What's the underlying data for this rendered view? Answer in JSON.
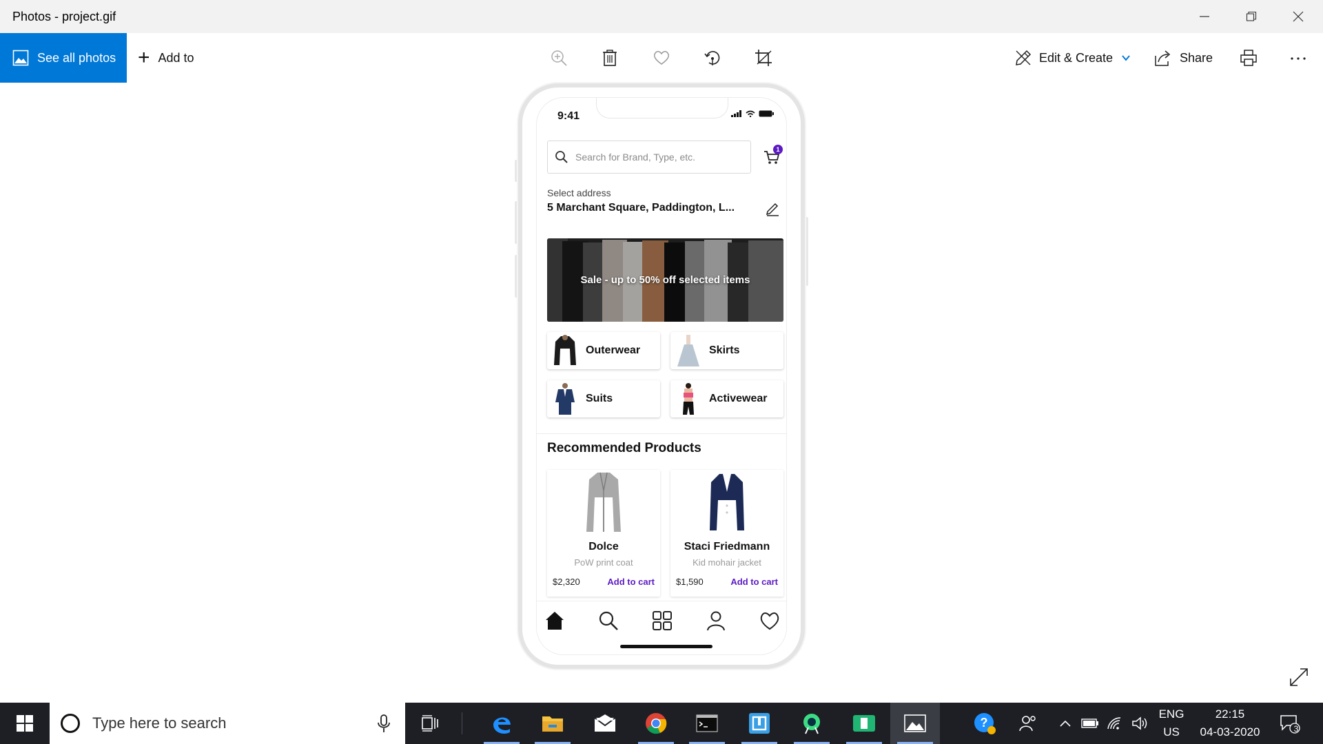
{
  "window": {
    "title": "Photos - project.gif",
    "minimize_icon": "minimize-icon",
    "maximize_icon": "restore-icon",
    "close_icon": "close-icon"
  },
  "toolbar": {
    "see_all_photos": "See all photos",
    "add_to": "Add to",
    "zoom_icon": "zoom-in-icon",
    "delete_icon": "trash-icon",
    "favorite_icon": "heart-icon",
    "rotate_icon": "rotate-icon",
    "crop_icon": "crop-icon",
    "edit_create": "Edit & Create",
    "share": "Share",
    "print_icon": "printer-icon",
    "more_icon": "more-icon"
  },
  "phone": {
    "time": "9:41",
    "search_placeholder": "Search for Brand, Type, etc.",
    "cart_count": "1",
    "address_label": "Select address",
    "address": "5 Marchant Square, Paddington, L...",
    "banner_text": "Sale - up to 50% off selected items",
    "categories": [
      {
        "name": "Outerwear",
        "icon": "black-jacket-thumbnail"
      },
      {
        "name": "Skirts",
        "icon": "tulle-skirt-thumbnail"
      },
      {
        "name": "Suits",
        "icon": "navy-suit-thumbnail"
      },
      {
        "name": "Activewear",
        "icon": "sports-bra-thumbnail"
      }
    ],
    "recommended_title": "Recommended Products",
    "products": [
      {
        "brand": "Dolce",
        "desc": "PoW print coat",
        "price": "$2,320",
        "cta": "Add to cart"
      },
      {
        "brand": "Staci Friedmann",
        "desc": "Kid mohair jacket",
        "price": "$1,590",
        "cta": "Add to cart"
      }
    ],
    "tabs": [
      "home-icon",
      "search-icon",
      "grid-icon",
      "profile-icon",
      "heart-icon"
    ],
    "accent_color": "#5c1ac3"
  },
  "taskbar": {
    "search_placeholder": "Type here to search",
    "apps": [
      "task-view-icon",
      "edge-icon",
      "file-explorer-icon",
      "mail-icon",
      "chrome-icon",
      "terminal-icon",
      "app-icon",
      "android-studio-icon",
      "app-green-icon",
      "photos-icon"
    ],
    "tray": {
      "lang_top": "ENG",
      "lang_bottom": "US",
      "time": "22:15",
      "date": "04-03-2020",
      "notifications": "3"
    }
  }
}
